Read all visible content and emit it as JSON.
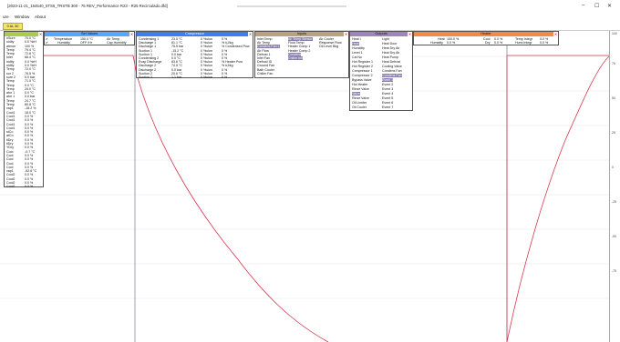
{
  "window": {
    "title": "[2023-11-21_154540_5TS6_TRSTB 300 - 75 REV_Performance R23 - R25 Recirculado.dfd]",
    "minimize": "–",
    "maximize": "☐",
    "close": "✕"
  },
  "menu": [
    "ure",
    "Window",
    "About"
  ],
  "toolbar": {
    "button_label": "0 AL 30"
  },
  "colors": {
    "curve": "#d43a4f",
    "set_values_head": "#58a6ff",
    "compressor_head": "#3d7df0",
    "inputs_head": "#b8a47a",
    "outputs_head": "#9f86b8",
    "heater_head": "#f08a4a",
    "measurements_head": "#a9cc4e"
  },
  "axis_right": [
    "100",
    "75",
    "50",
    "25",
    "0",
    "-25",
    "-50",
    "-75"
  ],
  "measurements": {
    "rows": [
      [
        "nSure",
        "70.0 °C"
      ],
      [
        "nidity",
        "0.0 %rH"
      ],
      [
        "ateron",
        "100 %"
      ],
      [
        "Temp",
        "79.4 °C"
      ],
      [
        "Temp",
        "72.8 °C"
      ],
      [
        "Inlet",
        "68.4 °C"
      ],
      [
        "nidity",
        "0.0 %rH"
      ],
      [
        "nidity",
        "0.0 %rH"
      ],
      [
        "Temp",
        "72.0 °C"
      ],
      [
        "sur 2",
        "76.5 %"
      ],
      [
        "sure 2",
        "0.0 bar"
      ],
      [
        "Temp",
        "71.0 °C"
      ],
      [
        "Temp",
        "0.0 °C"
      ],
      [
        "Temp",
        "20.0 °C"
      ],
      [
        "ator 1",
        "0.0 °C"
      ],
      [
        "ator 1",
        "0.0 bar"
      ],
      [
        "Temp",
        "24.7 °C"
      ],
      [
        "Temp",
        "80.8 °C"
      ],
      [
        "vap1",
        "-18.2 %"
      ],
      [
        "Cool1",
        "18.0 °C"
      ],
      [
        "Cool1",
        "0.0 %"
      ],
      [
        "Cool1",
        "0.0 %"
      ],
      [
        "Cool1",
        "0.0 %"
      ],
      [
        "Cool1",
        "0.0 %"
      ],
      [
        "stCo",
        "0.0 %"
      ],
      [
        "atCo",
        "0.0 %"
      ],
      [
        "tiDry",
        "0.0 %"
      ],
      [
        "tiDry",
        "0.0 %"
      ],
      [
        "YDry",
        "0.0 %"
      ],
      [
        "Cool",
        "-0.7 °C"
      ],
      [
        "Cool",
        "0.0 %"
      ],
      [
        "Cool",
        "0.0 %"
      ],
      [
        "Cool",
        "0.0 %"
      ],
      [
        "Cool",
        "0.0 %"
      ],
      [
        "vap1",
        "-52.6 °C"
      ],
      [
        "Cool2",
        "0.0 %"
      ],
      [
        "Cool2",
        "0.0 %"
      ],
      [
        "Cool2",
        "0.0 %"
      ],
      [
        "Cool2",
        "0.0 %"
      ]
    ]
  },
  "set_values": {
    "title": "Set Values",
    "rows": [
      {
        "check": "✔",
        "name": "Temperature",
        "value": "150.0 °C",
        "label": "Air Temp"
      },
      {
        "check": "✔",
        "name": "Humidity",
        "value": "OFF /Hr",
        "label": "Cap Humidity"
      }
    ]
  },
  "compressor": {
    "title": "Compressor",
    "rows": [
      [
        "Condensing 1",
        "23.5 °C",
        "0 %ulon",
        "0 %"
      ],
      [
        "Discharge 1",
        "81.1 °C",
        "0 %ulon",
        "% kJ/kg"
      ],
      [
        "Discharge 1",
        "75.5 bar",
        "0 %ulon",
        "% Condensed Pow"
      ],
      [
        "Suction 1",
        "-15.2 °C",
        "0 %ulon",
        "0 %"
      ],
      [
        "Suction 1",
        "0.0 bar",
        "0 %ulon",
        "0 %"
      ],
      [
        "Condensing 2",
        "0.0 °C",
        "0 %ulon",
        "0 %"
      ],
      [
        "Evap Discharge",
        "83.6 °C",
        "0 %ulon",
        "% Heater Pow"
      ],
      [
        "Discharge 2",
        "74.5 °C",
        "0 %ulon",
        "% kJ/kg"
      ],
      [
        "Discharge 2",
        "0.0 bar",
        "0 %ulon",
        "0 %"
      ],
      [
        "Suction 2",
        "20.6 °C",
        "0 %ulon",
        "0 %"
      ],
      [
        "Suction 2",
        "1.1 bar",
        "0 %ulon",
        "0 %"
      ]
    ]
  },
  "inputs": {
    "title": "Inputs",
    "col1": [
      "Inlet Temp",
      "Air Temp",
      "Condens Fan 1",
      "Air Flow",
      "Defrost 1",
      "Inlet Fan",
      "Defrost ID",
      "Ground Fan",
      "Bath Cooler",
      "Chiller Fan"
    ],
    "col2": [
      "Air Temp Sensor",
      "Fluid Temp",
      "Heater Comp 1",
      "Heater Comp 2",
      "Condens",
      "Chiller Inh"
    ],
    "col3": [
      "Air Cooler",
      "Response Flow",
      "Oil Level Bkg"
    ],
    "highlight_col1": [
      2
    ],
    "highlight_col2": [
      0,
      4,
      5
    ]
  },
  "outputs": {
    "title": "Outputs",
    "col1": [
      "Heat I",
      "Heat",
      "Humidity",
      "Level 1",
      "Cal No",
      "Hot Register 1",
      "Hot Register 2",
      "Compressor 1",
      "Compressor 2",
      "Bypass Valve",
      "Hot Heater",
      "Rinse Valve",
      "Valve",
      "Rinse Valve",
      "Oil Limiter",
      "Oil Cooler"
    ],
    "col2": [
      "Light",
      "Heat Door",
      "Heat Dry Air",
      "Heat Dry Air",
      "Heat Pump",
      "Heat Defrost",
      "Cooling Valve",
      "Condens Fan",
      "Condens Fan",
      "Event 1",
      "Event 2",
      "Event 3",
      "Event 4",
      "Event 5",
      "Event 6",
      "Event 7"
    ],
    "highlight_col1": [
      1,
      12
    ],
    "highlight_col2": [
      8,
      9
    ]
  },
  "heater": {
    "title": "Heater",
    "labels": [
      "Heat",
      "Humidity"
    ],
    "values": [
      "100.0 %",
      "0.0 %"
    ],
    "labels2": [
      "Cool",
      "Dry"
    ],
    "values2": [
      "0.0 %",
      "0.0 %"
    ],
    "labels3": [
      "Temp Integr",
      "Humi Integr"
    ],
    "values3": [
      "0.0 %",
      "0.0 %"
    ]
  },
  "chart_data": {
    "type": "line",
    "series": [
      {
        "values": [
          [
            0,
            77
          ],
          [
            2,
            77
          ],
          [
            3,
            45
          ],
          [
            6,
            10
          ],
          [
            10,
            -30
          ],
          [
            14,
            -55
          ],
          [
            18,
            -75
          ],
          [
            22,
            -82
          ]
        ]
      }
    ]
  }
}
